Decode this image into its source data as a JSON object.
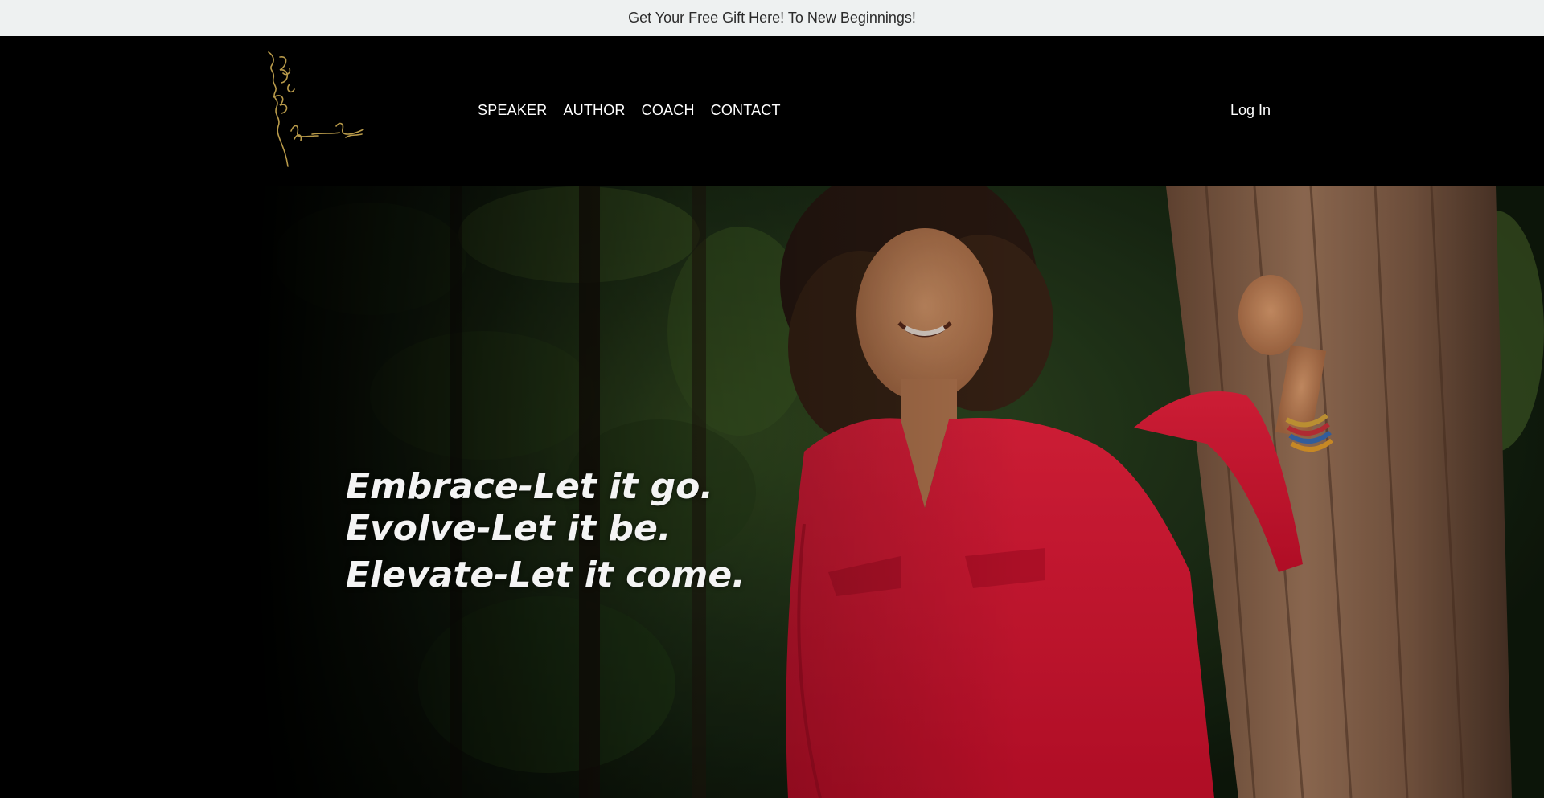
{
  "announcement": {
    "text": "Get Your Free Gift Here! To New Beginnings!"
  },
  "header": {
    "logo_icon": "signature-logo-icon",
    "nav": [
      {
        "label": "SPEAKER"
      },
      {
        "label": "AUTHOR"
      },
      {
        "label": "COACH"
      },
      {
        "label": "CONTACT"
      }
    ],
    "login_label": "Log In"
  },
  "hero": {
    "lines": [
      "Embrace-Let it go.",
      "Evolve-Let it be.",
      "Elevate-Let it come."
    ]
  },
  "colors": {
    "announcement_bg": "#eef1f1",
    "header_bg": "#000000",
    "logo_gold": "#b89a4a",
    "accent_red": "#e01a32"
  }
}
